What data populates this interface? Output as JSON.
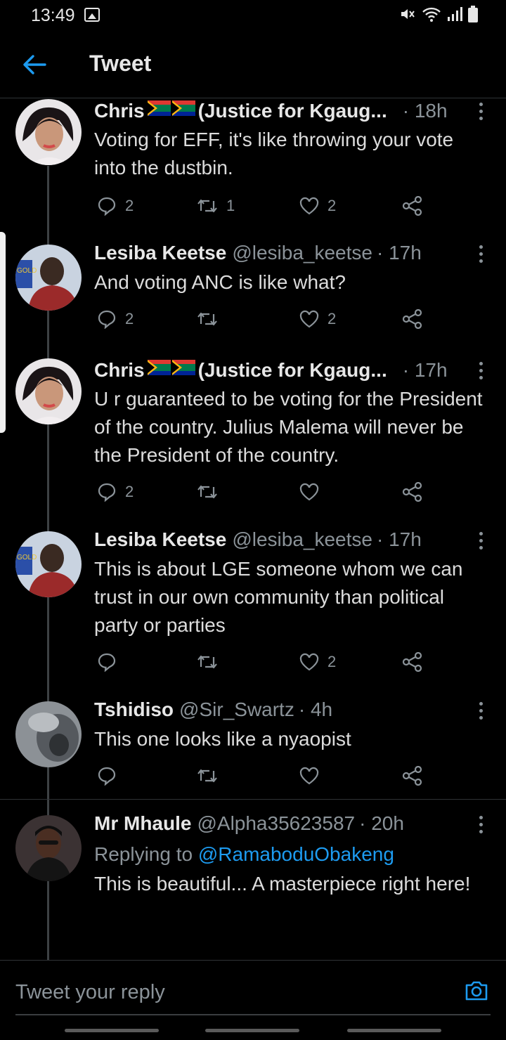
{
  "status_bar": {
    "time": "13:49"
  },
  "header": {
    "title": "Tweet"
  },
  "tweets": [
    {
      "name": "Chris",
      "name_suffix": "(Justice for Kgaug...",
      "handle": "",
      "time": "· 18h",
      "text": "Voting for EFF, it's like throwing your vote into the dustbin.",
      "replies": "2",
      "retweets": "1",
      "likes": "2"
    },
    {
      "name": "Lesiba Keetse",
      "name_suffix": "",
      "handle": "@lesiba_keetse",
      "time": "· 17h",
      "text": "And voting ANC is like what?",
      "replies": "2",
      "retweets": "",
      "likes": "2"
    },
    {
      "name": "Chris",
      "name_suffix": "(Justice for Kgaug...",
      "handle": "",
      "time": "· 17h",
      "text": "U r guaranteed to be voting for the President of the country. Julius Malema will never be the President of the country.",
      "replies": "2",
      "retweets": "",
      "likes": ""
    },
    {
      "name": "Lesiba Keetse",
      "name_suffix": "",
      "handle": "@lesiba_keetse",
      "time": "· 17h",
      "text": "This is about LGE someone whom we can trust in our own community than political party or parties",
      "replies": "",
      "retweets": "",
      "likes": "2"
    },
    {
      "name": "Tshidiso",
      "name_suffix": "",
      "handle": "@Sir_Swartz",
      "time": "· 4h",
      "text": "This one looks like a nyaopist",
      "replies": "",
      "retweets": "",
      "likes": ""
    },
    {
      "name": "Mr Mhaule",
      "name_suffix": "",
      "handle": "@Alpha35623587",
      "time": "· 20h",
      "reply_prefix": "Replying to",
      "reply_mention": "@RamaboduObakeng",
      "text": "This is beautiful... A masterpiece right here!",
      "replies": "",
      "retweets": "",
      "likes": ""
    }
  ],
  "compose": {
    "placeholder": "Tweet your reply"
  },
  "colors": {
    "background": "#000000",
    "accent": "#1d9bf0",
    "muted": "#8b9399",
    "divider": "#2f3336"
  },
  "icons": [
    "back-arrow-icon",
    "more-icon",
    "reply-icon",
    "retweet-icon",
    "like-icon",
    "share-icon",
    "camera-icon",
    "south-africa-flag-icon"
  ]
}
